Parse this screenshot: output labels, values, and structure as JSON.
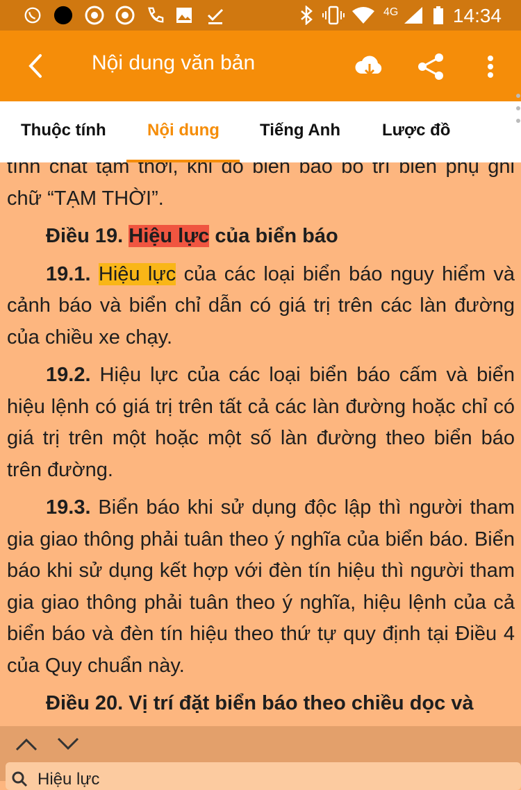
{
  "status_bar": {
    "time": "14:34",
    "network": "4G",
    "icons": [
      "viber-icon",
      "dot-icon",
      "chrome-icon",
      "chrome-icon",
      "phone-icon",
      "image-icon",
      "download-done-icon",
      "bluetooth-icon",
      "vibrate-icon",
      "wifi-icon",
      "signal-icon",
      "battery-icon"
    ]
  },
  "app_bar": {
    "title": "Nội dung văn bản",
    "actions": [
      "cloud-download-icon",
      "share-icon",
      "more-vert-icon"
    ]
  },
  "tabs": [
    {
      "label": "Thuộc tính"
    },
    {
      "label": "Nội dung",
      "active": true
    },
    {
      "label": "Tiếng Anh"
    },
    {
      "label": "Lược đồ"
    }
  ],
  "content": {
    "p0": "tính chất tạm thời, khi đó biển báo bố trí biển phụ ghi chữ “TẠM THỜI”.",
    "h19_pre": "Điều 19. ",
    "h19_hl": "Hiệu lực",
    "h19_post": " của biển báo",
    "p191_num": "19.1.",
    "p191_hl": "Hiệu lực",
    "p191_text": " của các loại biển báo nguy hiểm và cảnh báo và biển chỉ dẫn có giá trị trên các làn đường của chiều xe chạy.",
    "p192_num": "19.2.",
    "p192_text": " Hiệu lực của các loại biển báo cấm và biển hiệu lệnh có giá trị trên tất cả các làn đường hoặc chỉ có giá trị trên một hoặc một số làn đường theo biển báo trên đường.",
    "p193_num": "19.3.",
    "p193_text": " Biển báo khi sử dụng độc lập thì người tham gia giao thông phải tuân theo ý nghĩa của biển báo. Biển báo khi sử dụng kết hợp với đèn tín hiệu thì người tham gia giao thông phải tuân theo ý nghĩa, hiệu lệnh của cả biển báo và đèn tín hiệu theo thứ tự quy định tại Điều 4 của Quy chuẩn này.",
    "h20": "Điều 20. Vị trí đặt biển báo theo chiều dọc và"
  },
  "find_bar": {
    "query": "Hiệu lực",
    "prev_icon": "chevron-up-icon",
    "next_icon": "chevron-down-icon"
  },
  "colors": {
    "app_bar": "#f58d09",
    "status_bar": "#d07810",
    "page_bg": "#fdb67f",
    "highlight_current": "#f05540",
    "highlight_match": "#f9b617"
  }
}
